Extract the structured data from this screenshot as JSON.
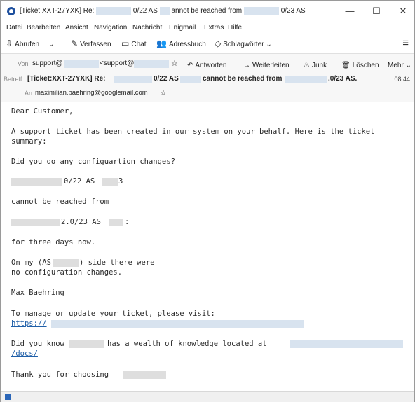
{
  "window": {
    "title_prefix": "[Ticket:XXT-27YXK] Re:",
    "title_mid1": "0/22 AS",
    "title_mid2": "annot be reached from",
    "title_mid3": "0/23 AS",
    "controls": [
      "—",
      "☐",
      "✕"
    ]
  },
  "menubar": [
    "Datei",
    "Bearbeiten",
    "Ansicht",
    "Navigation",
    "Nachricht",
    "Enigmail",
    "Extras",
    "Hilfe"
  ],
  "toolbar": {
    "fetch": "Abrufen",
    "compose": "Verfassen",
    "chat": "Chat",
    "addressbook": "Adressbuch",
    "tags": "Schlagwörter"
  },
  "header": {
    "from_label": "Von",
    "from_name": "support@",
    "from_addr": "<support@",
    "reply": "Antworten",
    "forward": "Weiterleiten",
    "junk": "Junk",
    "delete": "Löschen",
    "more": "Mehr",
    "subject_label": "Betreff",
    "subject_a": "[Ticket:XXT-27YXK] Re:",
    "subject_b": "0/22 AS",
    "subject_c": "cannot be reached from",
    "subject_d": ".0/23 AS.",
    "time": "08:44",
    "to_label": "An",
    "to_addr": "maximilian.baehring@googlemail.com"
  },
  "body": {
    "greeting": "Dear Customer,",
    "intro_1": "A support ticket has been created in our system on your behalf. Here is the ticket",
    "intro_2": "summary:",
    "question": "Did you do any configuartion changes?",
    "line_a": "0/22 AS",
    "line_a_tail": "3",
    "line_b": "cannot be reached from",
    "line_c": "2.0/23 AS",
    "line_c_tail": ":",
    "line_d": "for three days now.",
    "line_e1": "On my (AS",
    "line_e1b": ") side there were",
    "line_e2": "no configuration changes.",
    "signature": "Max Baehring",
    "manage": "To manage or update your ticket, please visit:",
    "manage_link": "https://",
    "did_you_know_a": "Did you know",
    "did_you_know_b": "has a wealth of knowledge located at",
    "docs_link": "/docs/",
    "thanks": "Thank you for choosing"
  },
  "icons": {
    "app": "thunderbird-icon",
    "status": "status-icon"
  }
}
